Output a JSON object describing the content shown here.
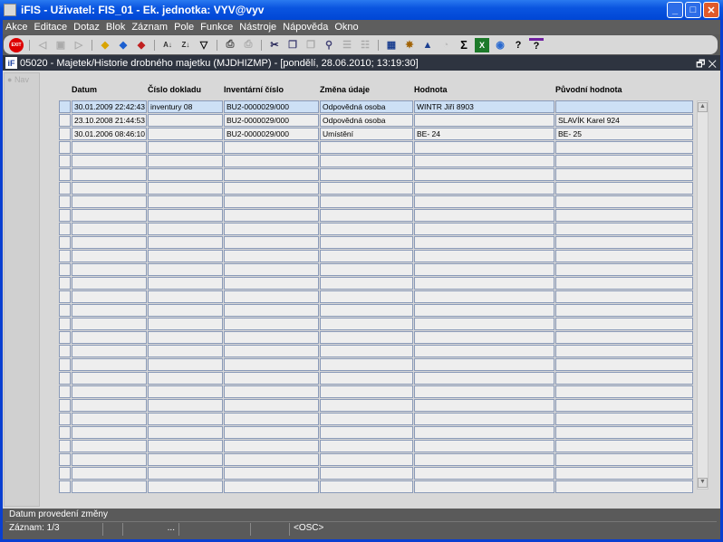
{
  "window": {
    "title": "iFIS - Uživatel: FIS_01 - Ek. jednotka: VYV@vyv"
  },
  "menu": [
    "Akce",
    "Editace",
    "Dotaz",
    "Blok",
    "Záznam",
    "Pole",
    "Funkce",
    "Nástroje",
    "Nápověda",
    "Okno"
  ],
  "toolbar": {
    "exit_label": "EXIT"
  },
  "form": {
    "title": "05020 - Majetek/Historie drobného majetku (MJDHIZMP) - [pondělí, 28.06.2010; 13:19:30]",
    "nav_label": "Nav"
  },
  "table": {
    "columns": [
      "Datum",
      "Číslo dokladu",
      "Inventární číslo",
      "Změna údaje",
      "Hodnota",
      "Původní hodnota"
    ],
    "rows": [
      [
        "30.01.2009 22:42:43",
        "inventury 08",
        "BU2-0000029/000",
        "Odpovědná osoba",
        "WINTR Jiří 8903",
        ""
      ],
      [
        "23.10.2008 21:44:53",
        "",
        "BU2-0000029/000",
        "Odpovědná osoba",
        "",
        "SLAVÍK Karel 924"
      ],
      [
        "30.01.2006 08:46:10",
        "",
        "BU2-0000029/000",
        "Umístění",
        "BE-   24",
        "BE-   25"
      ]
    ]
  },
  "status": {
    "hint": "Datum provedení změny",
    "record": "Záznam: 1/3",
    "ellipsis": "...",
    "mode": "<OSC>"
  }
}
